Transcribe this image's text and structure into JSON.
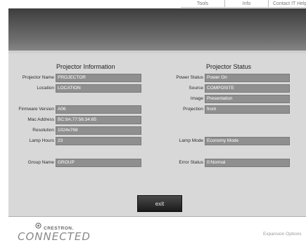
{
  "nav": {
    "tabs": [
      "Tools",
      "Info",
      "Contact IT Help"
    ]
  },
  "info": {
    "title": "Projector Information",
    "fields": [
      {
        "label": "Projector Name",
        "value": "PROJECTOR"
      },
      {
        "label": "Location",
        "value": "LOCATION"
      },
      {
        "label": "Firmware Version",
        "value": "A06"
      },
      {
        "label": "Mac Address",
        "value": "BC:9A:77:56:34:85"
      },
      {
        "label": "Resolution",
        "value": "1024x768"
      },
      {
        "label": "Lamp Hours",
        "value": "23"
      },
      {
        "label": "Group Name",
        "value": "GROUP"
      }
    ]
  },
  "status": {
    "title": "Projector Status",
    "fields": [
      {
        "label": "Power Status",
        "value": "Power On"
      },
      {
        "label": "Source",
        "value": "COMPOSITE"
      },
      {
        "label": "Image",
        "value": "Presentation"
      },
      {
        "label": "Projection",
        "value": "front"
      },
      {
        "label": "Lamp Mode",
        "value": "Economy Mode"
      },
      {
        "label": "Error Status",
        "value": "0:Normal"
      }
    ]
  },
  "exit_label": "exit",
  "footer": {
    "brand_top": "CRESTRON.",
    "brand_main": "CONNECTED",
    "expansion_label": "Expansion Options"
  },
  "colors": {
    "header_dark": "#3d3d3d",
    "panel_bg": "#d8d8d8",
    "field_bg": "#8f8f8f"
  }
}
